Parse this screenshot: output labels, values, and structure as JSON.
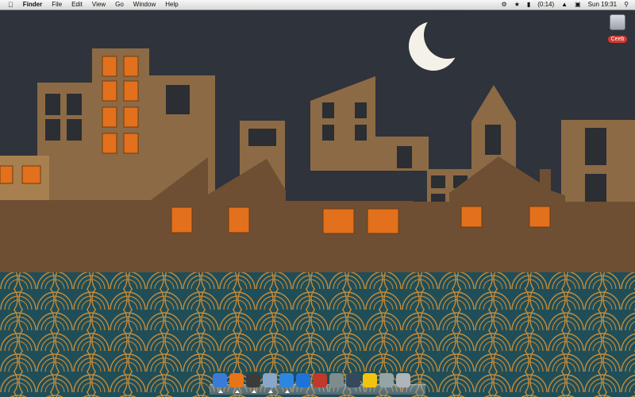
{
  "menubar": {
    "app_name": "Finder",
    "menus": [
      "File",
      "Edit",
      "View",
      "Go",
      "Window",
      "Help"
    ],
    "battery": "(0:14)",
    "clock": "Sun 19:31"
  },
  "desktop": {
    "drive_label": "Ceeb"
  },
  "dock": {
    "items": [
      {
        "name": "finder",
        "color": "#3a7bd5",
        "running": true
      },
      {
        "name": "firefox",
        "color": "#e8741a",
        "running": true
      },
      {
        "name": "adium",
        "color": "#3b3b3b",
        "running": true
      },
      {
        "name": "preview",
        "color": "#8aa6c8",
        "running": true
      },
      {
        "name": "safari",
        "color": "#2e86de",
        "running": true
      },
      {
        "name": "quicktime",
        "color": "#1e73d8",
        "running": false
      },
      {
        "name": "photo-booth",
        "color": "#c0392b",
        "running": false
      },
      {
        "name": "system-preferences",
        "color": "#7f8c8d",
        "running": false
      },
      {
        "name": "dvd-player",
        "color": "#34495e",
        "running": false
      },
      {
        "name": "stickies",
        "color": "#f1c40f",
        "running": false
      },
      {
        "name": "calculator",
        "color": "#95a5a6",
        "running": false
      },
      {
        "name": "trash",
        "color": "#b0b5ba",
        "running": false
      }
    ]
  }
}
